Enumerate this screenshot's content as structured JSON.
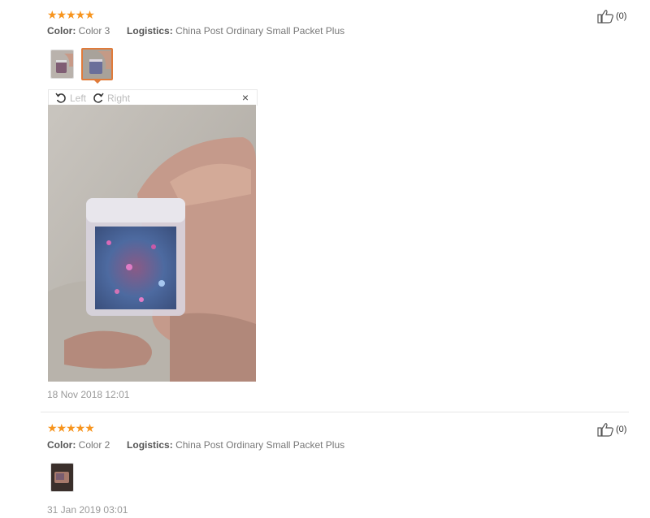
{
  "reviews": [
    {
      "stars": "★★★★★",
      "color_label": "Color:",
      "color_value": "Color 3",
      "logistics_label": "Logistics:",
      "logistics_value": "China Post Ordinary Small Packet Plus",
      "like_count": "(0)",
      "viewer": {
        "left_label": "Left",
        "right_label": "Right",
        "close": "×"
      },
      "date": "18 Nov 2018 12:01"
    },
    {
      "stars": "★★★★★",
      "color_label": "Color:",
      "color_value": "Color 2",
      "logistics_label": "Logistics:",
      "logistics_value": "China Post Ordinary Small Packet Plus",
      "like_count": "(0)",
      "date": "31 Jan 2019 03:01"
    }
  ],
  "colors": {
    "star": "#f7941d",
    "active_border": "#e07b3a"
  },
  "icons": [
    "thumbs-up-icon",
    "rotate-left-icon",
    "rotate-right-icon",
    "close-icon"
  ]
}
